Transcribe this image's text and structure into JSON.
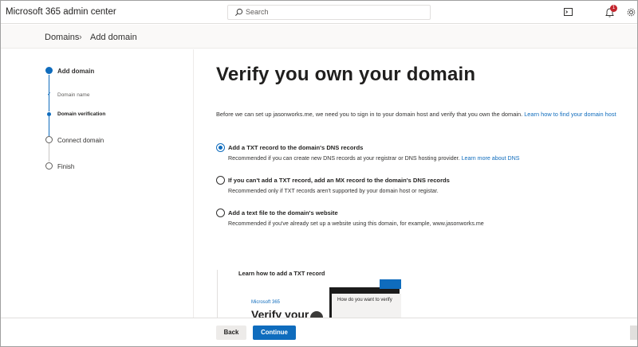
{
  "app": {
    "title": "Microsoft 365 admin center"
  },
  "search": {
    "placeholder": "Search"
  },
  "header": {
    "notification_count": "1"
  },
  "breadcrumb": {
    "parent": "Domains",
    "current": "Add domain"
  },
  "steps": {
    "add_domain": "Add domain",
    "domain_name": "Domain name",
    "domain_verification": "Domain verification",
    "connect_domain": "Connect domain",
    "finish": "Finish"
  },
  "main": {
    "title": "Verify you own your domain",
    "intro": "Before we can set up jasonworks.me, we need you to sign in to your domain host and verify that you own the domain.",
    "intro_link": "Learn how to find your domain host",
    "options": [
      {
        "title": "Add a TXT record to the domain's DNS records",
        "desc": "Recommended if you can create new DNS records at your registrar or DNS hosting provider.",
        "link": "Learn more about DNS",
        "checked": true
      },
      {
        "title": "If you can't add a TXT record, add an MX record to the domain's DNS records",
        "desc": "Recommended only if TXT records aren't supported by your domain host or registar.",
        "checked": false
      },
      {
        "title": "Add a text file to the domain's website",
        "desc": "Recommended if you've already set up a website using this domain, for example, www.jasonworks.me",
        "checked": false
      }
    ],
    "video": {
      "title": "Learn how to add a TXT record",
      "brand": "Microsoft 365",
      "headline": "Verify your",
      "screen_text": "How do you want to verify"
    }
  },
  "footer": {
    "back_label": "Back",
    "continue_label": "Continue"
  },
  "colors": {
    "accent": "#0f6cbd",
    "badge": "#c4262e"
  }
}
